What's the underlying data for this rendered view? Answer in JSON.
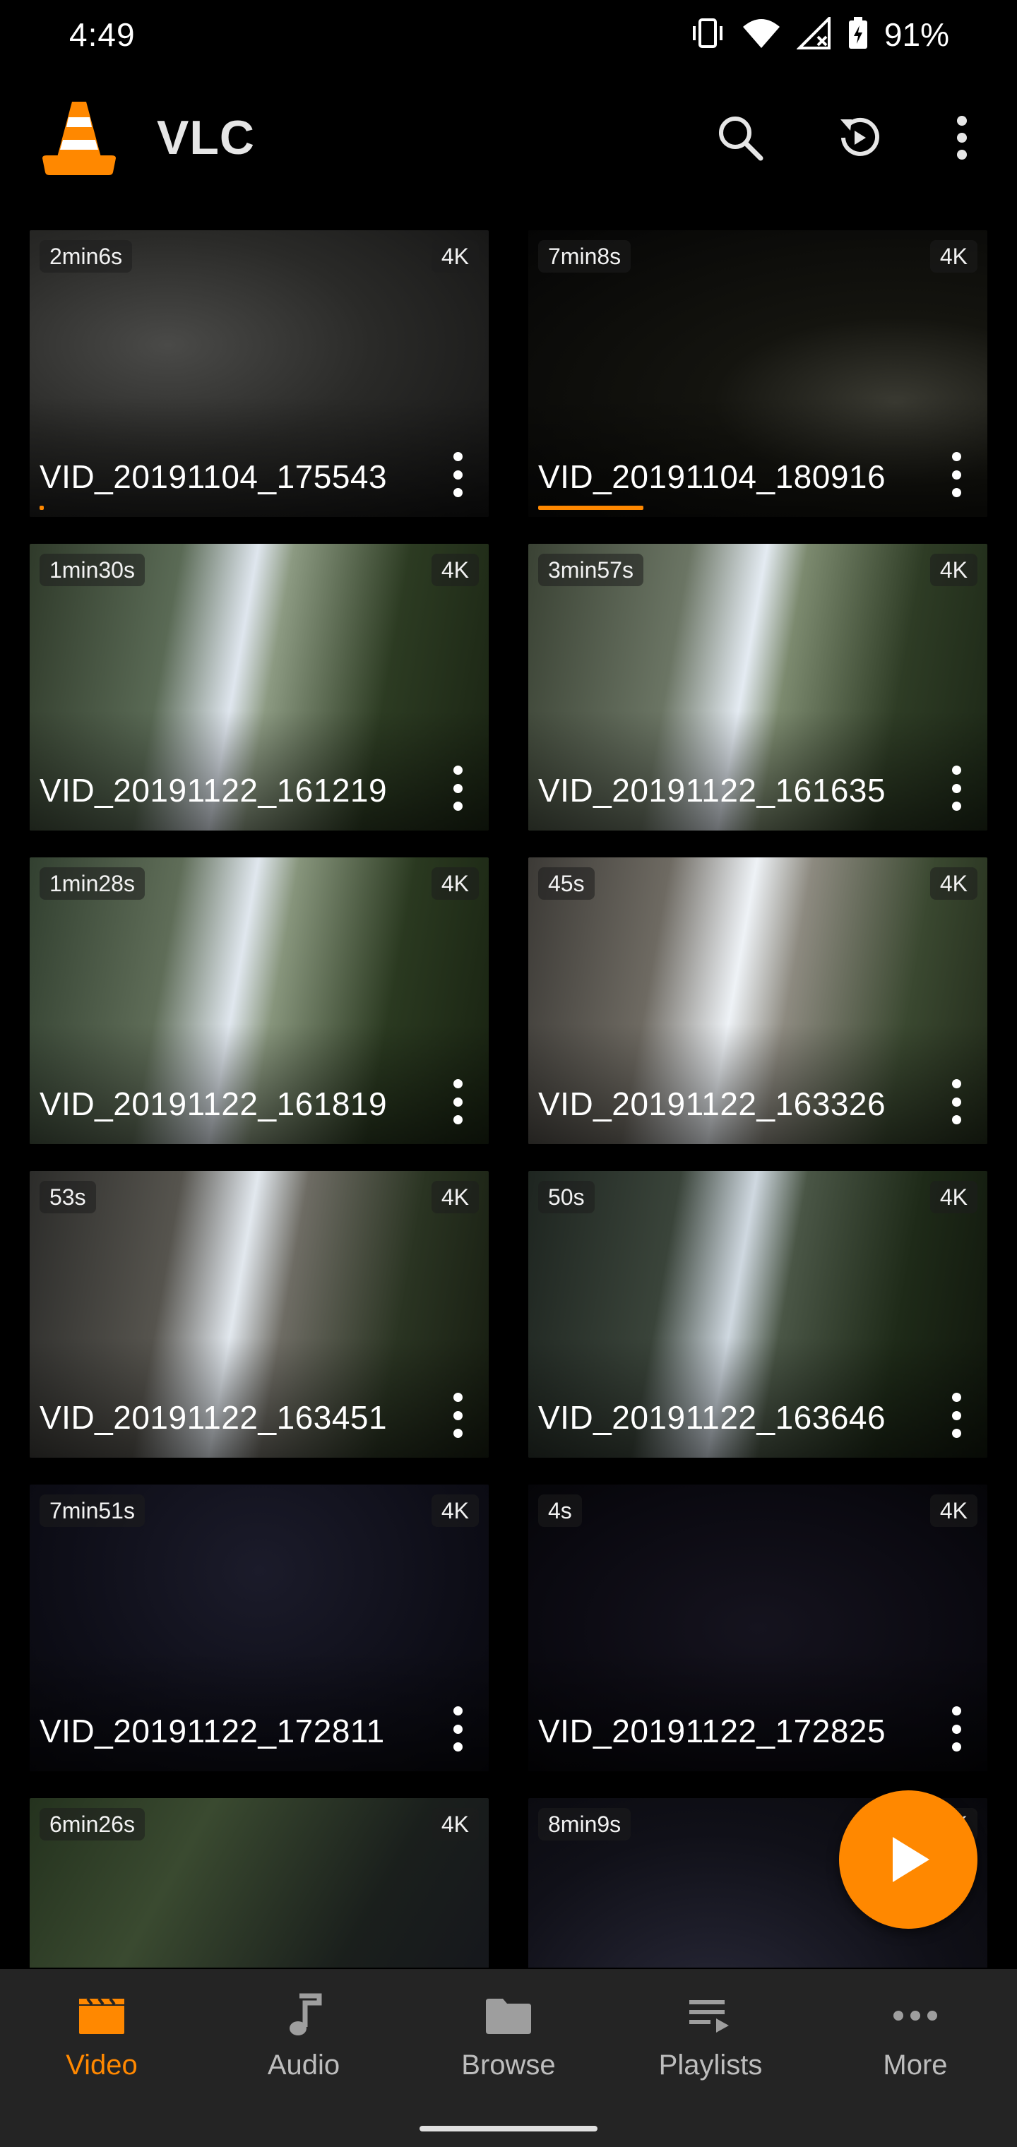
{
  "status": {
    "time": "4:49",
    "battery": "91%"
  },
  "app": {
    "title": "VLC"
  },
  "colors": {
    "accent": "#ff8800",
    "nav_bg": "#242424",
    "background": "#000000"
  },
  "videos": [
    {
      "title": "VID_20191104_175543",
      "duration": "2min6s",
      "resolution": "4K",
      "progress": 0.01
    },
    {
      "title": "VID_20191104_180916",
      "duration": "7min8s",
      "resolution": "4K",
      "progress": 0.24
    },
    {
      "title": "VID_20191122_161219",
      "duration": "1min30s",
      "resolution": "4K"
    },
    {
      "title": "VID_20191122_161635",
      "duration": "3min57s",
      "resolution": "4K"
    },
    {
      "title": "VID_20191122_161819",
      "duration": "1min28s",
      "resolution": "4K"
    },
    {
      "title": "VID_20191122_163326",
      "duration": "45s",
      "resolution": "4K"
    },
    {
      "title": "VID_20191122_163451",
      "duration": "53s",
      "resolution": "4K"
    },
    {
      "title": "VID_20191122_163646",
      "duration": "50s",
      "resolution": "4K"
    },
    {
      "title": "VID_20191122_172811",
      "duration": "7min51s",
      "resolution": "4K"
    },
    {
      "title": "VID_20191122_172825",
      "duration": "4s",
      "resolution": "4K"
    },
    {
      "title": "",
      "duration": "6min26s",
      "resolution": "4K"
    },
    {
      "title": "",
      "duration": "8min9s",
      "resolution": "4K"
    }
  ],
  "nav": [
    {
      "label": "Video",
      "icon": "movie-clapper-icon",
      "active": true
    },
    {
      "label": "Audio",
      "icon": "music-note-icon"
    },
    {
      "label": "Browse",
      "icon": "folder-icon"
    },
    {
      "label": "Playlists",
      "icon": "playlist-icon"
    },
    {
      "label": "More",
      "icon": "more-horizontal-icon"
    }
  ]
}
